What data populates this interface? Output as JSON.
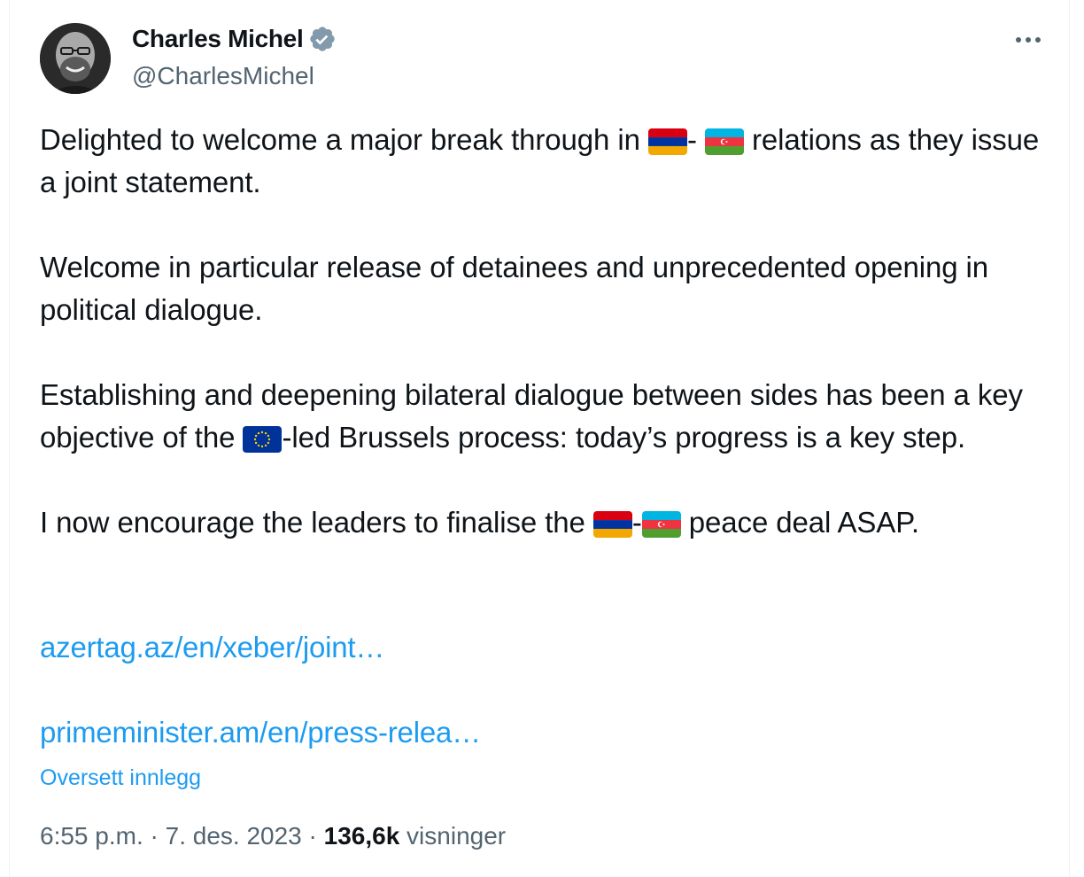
{
  "author": {
    "display_name": "Charles Michel",
    "handle": "@CharlesMichel",
    "verified": true
  },
  "icons": {
    "verified": "verified-badge-icon",
    "more": "more-options-icon",
    "flag_armenia": "flag-armenia-icon",
    "flag_azerbaijan": "flag-azerbaijan-icon",
    "flag_eu": "flag-eu-icon"
  },
  "tweet": {
    "p1_a": "Delighted to welcome a major break through in ",
    "p1_dash": "- ",
    "p1_b": " relations as they issue a joint statement.",
    "p2": "Welcome in particular release of detainees and unprecedented opening in political dialogue.",
    "p3_a": "Establishing and deepening bilateral dialogue between sides has been a key objective of the ",
    "p3_b": "-led Brussels process: today’s progress is a key step.",
    "p4_a": "I now encourage the leaders to finalise the ",
    "p4_dash": "-",
    "p4_b": " peace deal ASAP."
  },
  "links": {
    "link1": "azertag.az/en/xeber/joint…",
    "link2": "primeminister.am/en/press-relea…"
  },
  "translate_label": "Oversett innlegg",
  "meta": {
    "time": "6:55 p.m.",
    "sep1": " · ",
    "date": "7. des. 2023",
    "sep2": " · ",
    "views_count": "136,6k",
    "views_label": " visninger"
  },
  "colors": {
    "accent": "#1d9bf0",
    "secondary_text": "#536471",
    "primary_text": "#0f1419"
  }
}
